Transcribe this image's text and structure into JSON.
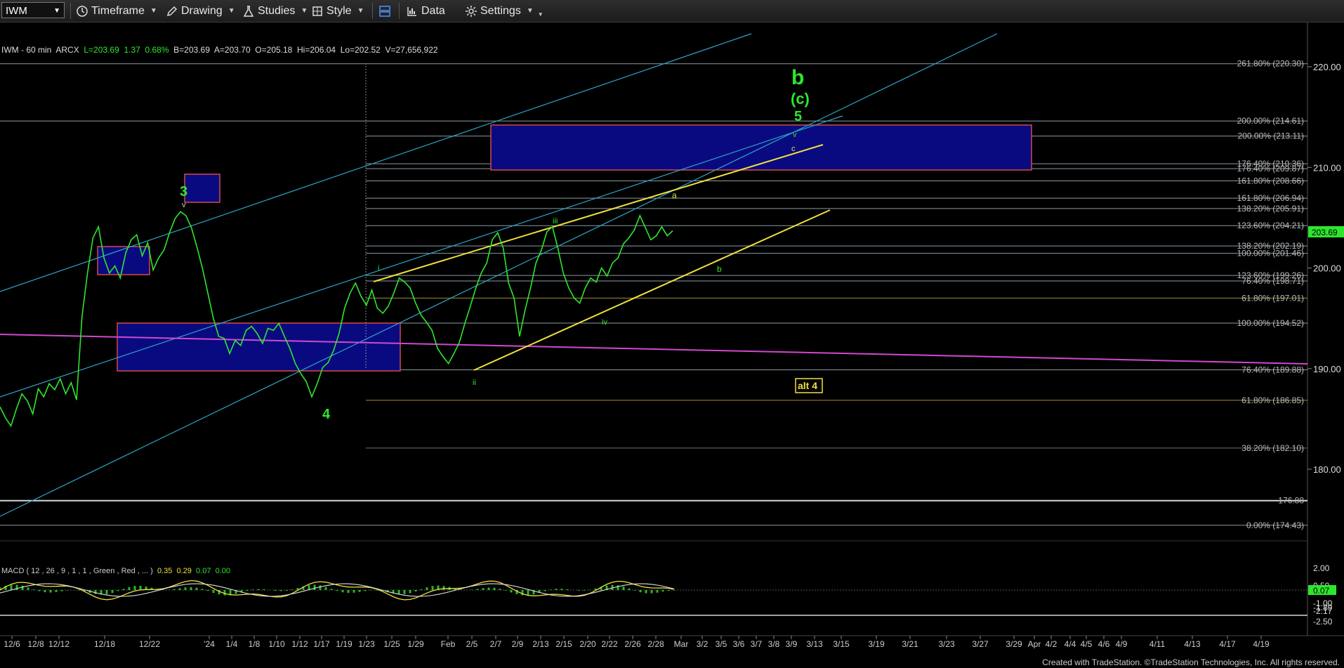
{
  "toolbar": {
    "symbol": "IWM",
    "timeframe_label": "Timeframe",
    "drawing_label": "Drawing",
    "studies_label": "Studies",
    "style_label": "Style",
    "data_label": "Data",
    "settings_label": "Settings"
  },
  "info_line": {
    "symbol_interval": "IWM - 60 min",
    "exchange": "ARCX",
    "last": "L=203.69",
    "change": "1.37",
    "change_pct": "0.68%",
    "bid": "B=203.69",
    "ask": "A=203.70",
    "open": "O=205.18",
    "high": "Hi=206.04",
    "low": "Lo=202.52",
    "volume": "V=27,656,922"
  },
  "macd": {
    "label": "MACD ( 12 , 26 , 9 , 1 , 1 , Green , Red , ... )",
    "v1": "0.35",
    "v2": "0.29",
    "v3": "0.07",
    "v4": "0.00"
  },
  "chart_data": {
    "type": "line",
    "title": "IWM - 60 min",
    "ylim": [
      170.5,
      225.0
    ],
    "price_axis_ticks": [
      "220.00",
      "210.00",
      "200.00",
      "190.00",
      "180.00"
    ],
    "current_price": "203.69",
    "x_ticks": [
      "12/6",
      "12/8",
      "12/12",
      "12/18",
      "12/22",
      "'24",
      "1/4",
      "1/8",
      "1/10",
      "1/12",
      "1/17",
      "1/19",
      "1/23",
      "1/25",
      "1/29",
      "Feb",
      "2/5",
      "2/7",
      "2/9",
      "2/13",
      "2/15",
      "2/20",
      "2/22",
      "2/26",
      "2/28",
      "Mar",
      "3/2",
      "3/5",
      "3/6",
      "3/7",
      "3/8",
      "3/9",
      "3/13",
      "3/15",
      "3/19",
      "3/21",
      "3/23",
      "3/27",
      "3/29",
      "Apr",
      "4/2",
      "4/4",
      "4/5",
      "4/6",
      "4/9",
      "4/11",
      "4/13",
      "4/17",
      "4/19"
    ],
    "fib_levels": [
      {
        "label": "261.80% (220.30)",
        "value": 220.3
      },
      {
        "label": "200.00% (214.61)",
        "value": 214.61
      },
      {
        "label": "200.00% (213.11)",
        "value": 213.11
      },
      {
        "label": "176.40% (210.36)",
        "value": 210.36
      },
      {
        "label": "176.40% (209.87)",
        "value": 209.87
      },
      {
        "label": "161.80% (208.66)",
        "value": 208.66
      },
      {
        "label": "161.80% (206.94)",
        "value": 206.94
      },
      {
        "label": "138.20% (205.91)",
        "value": 205.91
      },
      {
        "label": "123.60% (204.21)",
        "value": 204.21
      },
      {
        "label": "138.20% (202.19)",
        "value": 202.19
      },
      {
        "label": "100.00% (201.46)",
        "value": 201.46
      },
      {
        "label": "123.60% (199.26)",
        "value": 199.26
      },
      {
        "label": "76.40% (198.71)",
        "value": 198.71
      },
      {
        "label": "61.80% (197.01)",
        "value": 197.01
      },
      {
        "label": "100.00% (194.52)",
        "value": 194.52
      },
      {
        "label": "76.40% (189.88)",
        "value": 189.88
      },
      {
        "label": "61.80% (186.85)",
        "value": 186.85
      },
      {
        "label": "38.20% (182.10)",
        "value": 182.1
      },
      {
        "label": "176.88",
        "value": 176.88
      },
      {
        "label": "0.00% (174.43)",
        "value": 174.43
      }
    ],
    "wave_labels": [
      "b",
      "(c)",
      "5",
      "3",
      "4",
      "v",
      "c",
      "a",
      "iii",
      "i",
      "ii",
      "iv",
      "b",
      "v",
      "alt 4"
    ],
    "macd_axis_ticks": [
      "2.00",
      "0.50",
      "0.07",
      "-1.00",
      "-1.89",
      "-2.17",
      "-2.50"
    ],
    "series": [
      {
        "values": [
          186.2,
          185.1,
          184.3,
          186.0,
          187.5,
          186.8,
          185.5,
          188.0,
          187.2,
          188.5,
          187.9,
          189.0,
          187.5,
          188.6,
          186.9,
          195.2,
          199.5,
          203.0,
          204.1,
          201.0,
          199.5,
          200.2,
          199.0,
          201.5,
          202.8,
          203.3,
          201.2,
          202.5,
          199.8,
          201.0,
          201.8,
          203.5,
          204.9,
          205.6,
          205.2,
          204.0,
          202.1,
          200.0,
          197.5,
          195.0,
          193.2,
          193.0,
          191.5,
          192.8,
          192.3,
          193.8,
          194.2,
          193.5,
          192.5,
          194.0,
          193.8,
          194.5,
          193.2,
          192.0,
          190.5,
          189.5,
          188.7,
          187.2,
          188.5,
          190.1,
          190.6,
          191.8,
          193.5,
          196.0,
          197.5,
          198.5,
          197.2,
          196.3,
          197.8,
          196.0,
          195.5,
          196.2,
          197.5,
          199.0,
          198.6,
          198.0,
          196.5,
          195.3,
          194.6,
          193.8,
          192.0,
          191.2,
          190.5,
          191.5,
          192.6,
          194.5,
          196.2,
          198.0,
          199.5,
          200.5,
          202.8,
          203.5,
          202.0,
          198.5,
          197.0,
          193.2,
          195.8,
          198.0,
          200.5,
          201.8,
          203.6,
          204.1,
          202.0,
          199.5,
          198.0,
          197.0,
          196.5,
          198.0,
          199.0,
          198.6,
          200.0,
          199.2,
          200.5,
          201.0,
          202.4,
          203.0,
          203.8,
          205.2,
          204.0,
          202.8,
          203.2,
          204.1,
          203.2,
          203.69
        ]
      }
    ]
  }
}
